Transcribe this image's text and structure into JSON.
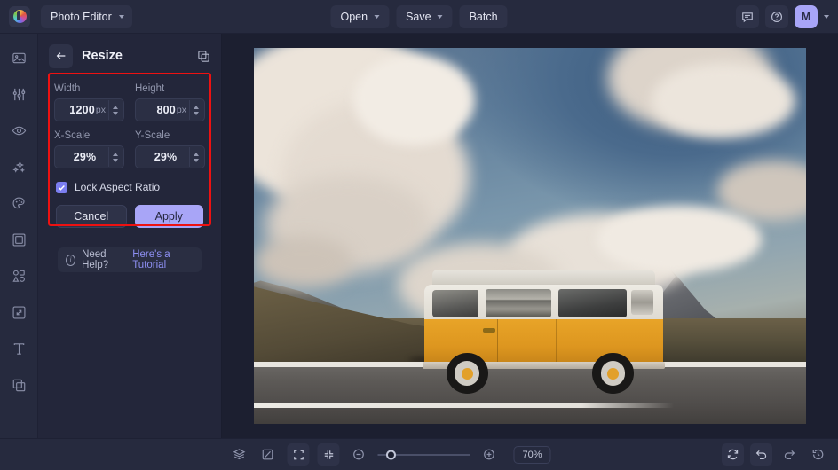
{
  "topbar": {
    "logo_icon": "color-wheel-logo-icon",
    "app_name": "Photo Editor",
    "app_caret_icon": "chevron-down-icon",
    "open_label": "Open",
    "open_caret_icon": "chevron-down-icon",
    "save_label": "Save",
    "save_caret_icon": "chevron-down-icon",
    "batch_label": "Batch",
    "feedback_icon": "comment-icon",
    "help_icon": "question-circle-icon",
    "avatar_initial": "M",
    "avatar_caret_icon": "chevron-down-icon"
  },
  "rail": {
    "items": [
      {
        "icon": "image-icon",
        "name": "sidebar-item-image"
      },
      {
        "icon": "adjustments-sliders-icon",
        "name": "sidebar-item-adjust"
      },
      {
        "icon": "eye-icon",
        "name": "sidebar-item-retouch"
      },
      {
        "icon": "sparkles-icon",
        "name": "sidebar-item-effects"
      },
      {
        "icon": "palette-icon",
        "name": "sidebar-item-color"
      },
      {
        "icon": "frame-icon",
        "name": "sidebar-item-frame"
      },
      {
        "icon": "shapes-icon",
        "name": "sidebar-item-shapes"
      },
      {
        "icon": "resize-icon",
        "name": "sidebar-item-resize"
      },
      {
        "icon": "text-icon",
        "name": "sidebar-item-text"
      },
      {
        "icon": "layers-stack-icon",
        "name": "sidebar-item-layers"
      }
    ]
  },
  "panel": {
    "back_icon": "arrow-left-icon",
    "title": "Resize",
    "duplicate_icon": "duplicate-icon",
    "width": {
      "label": "Width",
      "value": "1200",
      "unit": "px"
    },
    "height": {
      "label": "Height",
      "value": "800",
      "unit": "px"
    },
    "xscale": {
      "label": "X-Scale",
      "value": "29%"
    },
    "yscale": {
      "label": "Y-Scale",
      "value": "29%"
    },
    "lock_aspect": {
      "label": "Lock Aspect Ratio",
      "checked": true,
      "check_icon": "checkmark-icon"
    },
    "cancel_label": "Cancel",
    "apply_label": "Apply",
    "help": {
      "info_icon": "info-circle-icon",
      "text": "Need Help?",
      "link": "Here's a Tutorial"
    },
    "highlight_color": "#ee1111"
  },
  "canvas": {
    "image_description": "Orange and white vintage camper van parked on a roadside with snow-capped mountains and clouds"
  },
  "bottombar": {
    "layers_icon": "layers-icon",
    "compare_icon": "compare-split-icon",
    "grid_icon": "grid-icon",
    "fit_icon": "fit-screen-icon",
    "shrink_icon": "collapse-arrows-icon",
    "zoom_out_icon": "minus-circle-icon",
    "zoom_in_icon": "plus-circle-icon",
    "zoom_level": "70%",
    "reset_icon": "refresh-icon",
    "undo_icon": "undo-arrow-icon",
    "redo_icon": "redo-arrow-icon",
    "history_icon": "history-clock-icon"
  },
  "colors": {
    "accent": "#a8a5f7",
    "panel_bg": "#23263a",
    "bar_bg": "#262a3e",
    "canvas_bg": "#1c1f30",
    "highlight": "#ee1111"
  }
}
